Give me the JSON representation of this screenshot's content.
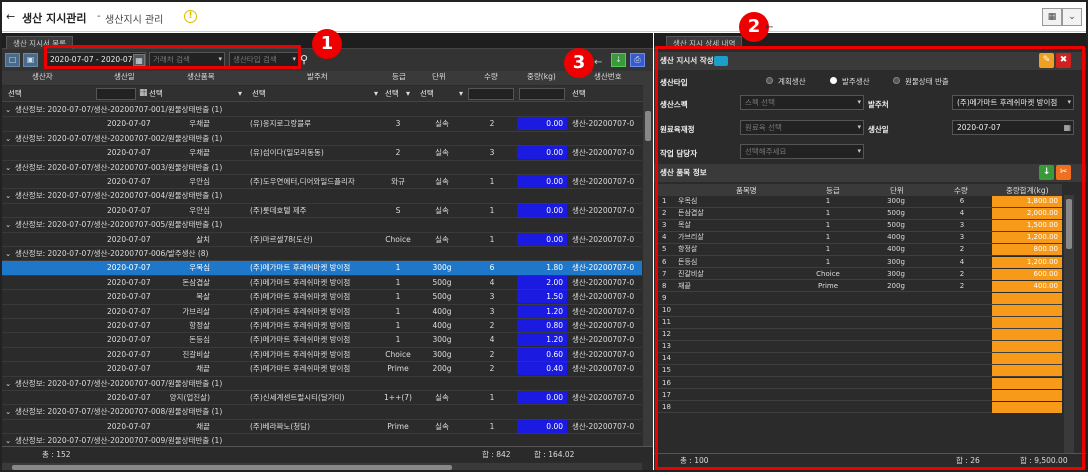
{
  "title": {
    "main": "생산 지시관리",
    "sep": " - ",
    "sub": "생산지시 관리",
    "info": "!"
  },
  "left_panel": {
    "tab": "생산 지시서 목록",
    "filters": {
      "date_range": "2020-07-07 - 2020-07-07",
      "client_placeholder": "거래처 검색",
      "type_placeholder": "생산타입 검색"
    },
    "columns": [
      "생산자",
      "생산일",
      "생산품목",
      "발주처",
      "등급",
      "단위",
      "수량",
      "중량(kg)",
      "생산번호"
    ],
    "filter_row": {
      "sel": "선택"
    },
    "rows": [
      {
        "type": "group",
        "label": "생산정보: 2020-07-07/생산-20200707-001/원물상태반출 (1)"
      },
      {
        "type": "item",
        "date": "2020-07-07",
        "item": "우채끝",
        "client": "(유)옹지로그랑블루",
        "grade": "3",
        "unit": "실속",
        "qty": "2",
        "weight": "0.00",
        "no": "생산-20200707-0"
      },
      {
        "type": "group",
        "label": "생산정보: 2020-07-07/생산-20200707-002/원물상태반출 (1)"
      },
      {
        "type": "item",
        "date": "2020-07-07",
        "item": "우채끝",
        "client": "(유)섬이다(일모리동동)",
        "grade": "2",
        "unit": "실속",
        "qty": "3",
        "weight": "0.00",
        "no": "생산-20200707-0"
      },
      {
        "type": "group",
        "label": "생산정보: 2020-07-07/생산-20200707-003/원물상태반출 (1)"
      },
      {
        "type": "item",
        "date": "2020-07-07",
        "item": "우안심",
        "client": "(주)도우연에터,디어와일드플리자",
        "grade": "와규",
        "unit": "실속",
        "qty": "1",
        "weight": "0.00",
        "no": "생산-20200707-0"
      },
      {
        "type": "group",
        "label": "생산정보: 2020-07-07/생산-20200707-004/원물상태반출 (1)"
      },
      {
        "type": "item",
        "date": "2020-07-07",
        "item": "우안심",
        "client": "(주)롯데호텔 제주",
        "grade": "S",
        "unit": "실속",
        "qty": "1",
        "weight": "0.00",
        "no": "생산-20200707-0"
      },
      {
        "type": "group",
        "label": "생산정보: 2020-07-07/생산-20200707-005/원물상태반출 (1)"
      },
      {
        "type": "item",
        "date": "2020-07-07",
        "item": "살치",
        "client": "(주)마르셀78(도산)",
        "grade": "Choice",
        "unit": "실속",
        "qty": "1",
        "weight": "0.00",
        "no": "생산-20200707-0"
      },
      {
        "type": "group",
        "label": "생산정보: 2020-07-07/생산-20200707-006/발주생산 (8)"
      },
      {
        "type": "item",
        "selected": true,
        "date": "2020-07-07",
        "item": "우목심",
        "client": "(주)메가마트 후레쉬마켓 방이점",
        "grade": "1",
        "unit": "300g",
        "qty": "6",
        "weight": "1.80",
        "no": "생산-20200707-0"
      },
      {
        "type": "item",
        "date": "2020-07-07",
        "item": "돈삼겹살",
        "client": "(주)메가마트 후레쉬마켓 방이점",
        "grade": "1",
        "unit": "500g",
        "qty": "4",
        "weight": "2.00",
        "no": "생산-20200707-0"
      },
      {
        "type": "item",
        "date": "2020-07-07",
        "item": "목살",
        "client": "(주)메가마트 후레쉬마켓 방이점",
        "grade": "1",
        "unit": "500g",
        "qty": "3",
        "weight": "1.50",
        "no": "생산-20200707-0"
      },
      {
        "type": "item",
        "date": "2020-07-07",
        "item": "가브리살",
        "client": "(주)메가마트 후레쉬마켓 방이점",
        "grade": "1",
        "unit": "400g",
        "qty": "3",
        "weight": "1.20",
        "no": "생산-20200707-0"
      },
      {
        "type": "item",
        "date": "2020-07-07",
        "item": "항정살",
        "client": "(주)메가마트 후레쉬마켓 방이점",
        "grade": "1",
        "unit": "400g",
        "qty": "2",
        "weight": "0.80",
        "no": "생산-20200707-0"
      },
      {
        "type": "item",
        "date": "2020-07-07",
        "item": "돈등심",
        "client": "(주)메가마트 후레쉬마켓 방이점",
        "grade": "1",
        "unit": "300g",
        "qty": "4",
        "weight": "1.20",
        "no": "생산-20200707-0"
      },
      {
        "type": "item",
        "date": "2020-07-07",
        "item": "진갈비살",
        "client": "(주)메가마트 후레쉬마켓 방이점",
        "grade": "Choice",
        "unit": "300g",
        "qty": "2",
        "weight": "0.60",
        "no": "생산-20200707-0"
      },
      {
        "type": "item",
        "date": "2020-07-07",
        "item": "채끝",
        "client": "(주)메가마트 후레쉬마켓 방이점",
        "grade": "Prime",
        "unit": "200g",
        "qty": "2",
        "weight": "0.40",
        "no": "생산-20200707-0"
      },
      {
        "type": "group",
        "label": "생산정보: 2020-07-07/생산-20200707-007/원물상태반출 (1)"
      },
      {
        "type": "item",
        "date": "2020-07-07",
        "item": "양지(업진살)",
        "client": "(주)신세계센트럴시티(달가미)",
        "grade": "1++(7)",
        "unit": "실속",
        "qty": "1",
        "weight": "0.00",
        "no": "생산-20200707-0"
      },
      {
        "type": "group",
        "label": "생산정보: 2020-07-07/생산-20200707-008/원물상태반출 (1)"
      },
      {
        "type": "item",
        "date": "2020-07-07",
        "item": "채끝",
        "client": "(주)베라짜노(청담)",
        "grade": "Prime",
        "unit": "실속",
        "qty": "1",
        "weight": "0.00",
        "no": "생산-20200707-0"
      },
      {
        "type": "group",
        "label": "생산정보: 2020-07-07/생산-20200707-009/원물상태반출 (1)"
      }
    ],
    "footer": {
      "count": "총 : 152",
      "qty_sum": "합 : 842",
      "weight_sum": "합 : 164.02"
    }
  },
  "right_panel": {
    "tab": "생산 지시 상세 내역",
    "form_title": "생산 지시서 작성",
    "labels": {
      "type": "생산타입",
      "spec": "생산스펙",
      "client": "발주처",
      "raw": "원료육재정",
      "date": "생산일",
      "manager": "작업 담당자"
    },
    "radios": [
      "계획생산",
      "발주생산",
      "원물상태 반출"
    ],
    "inputs": {
      "spec_ph": "스펙 선택",
      "client": "(주)메가마트 후레쉬마켓 방이점",
      "raw_ph": "원료육 선택",
      "date": "2020-07-07",
      "manager_ph": "선택해주세요"
    },
    "items_title": "생산 품목 정보",
    "columns": [
      "품목명",
      "등급",
      "단위",
      "수량",
      "중량합계(kg)"
    ],
    "items": [
      {
        "n": "1",
        "name": "우목심",
        "grade": "1",
        "unit": "300g",
        "qty": "6",
        "weight": "1,800.00"
      },
      {
        "n": "2",
        "name": "돈삼겹살",
        "grade": "1",
        "unit": "500g",
        "qty": "4",
        "weight": "2,000.00"
      },
      {
        "n": "3",
        "name": "목살",
        "grade": "1",
        "unit": "500g",
        "qty": "3",
        "weight": "1,500.00"
      },
      {
        "n": "4",
        "name": "가브리살",
        "grade": "1",
        "unit": "400g",
        "qty": "3",
        "weight": "1,200.00"
      },
      {
        "n": "5",
        "name": "항정살",
        "grade": "1",
        "unit": "400g",
        "qty": "2",
        "weight": "800.00"
      },
      {
        "n": "6",
        "name": "돈등심",
        "grade": "1",
        "unit": "300g",
        "qty": "4",
        "weight": "1,200.00"
      },
      {
        "n": "7",
        "name": "진갈비살",
        "grade": "Choice",
        "unit": "300g",
        "qty": "2",
        "weight": "600.00"
      },
      {
        "n": "8",
        "name": "채끝",
        "grade": "Prime",
        "unit": "200g",
        "qty": "2",
        "weight": "400.00"
      },
      {
        "n": "9"
      },
      {
        "n": "10"
      },
      {
        "n": "11"
      },
      {
        "n": "12"
      },
      {
        "n": "13"
      },
      {
        "n": "14"
      },
      {
        "n": "15"
      },
      {
        "n": "16"
      },
      {
        "n": "17"
      },
      {
        "n": "18"
      }
    ],
    "footer": {
      "count": "총 : 100",
      "qty_sum": "합 : 26",
      "weight_sum": "합 : 9,500.00"
    }
  },
  "callouts": [
    "1",
    "2",
    "3"
  ],
  "colors": {
    "selected_row": "#1f77c9",
    "weight_cell": "#1a1ae0",
    "weight_total": "#f79a1a",
    "callout": "#e00000"
  }
}
